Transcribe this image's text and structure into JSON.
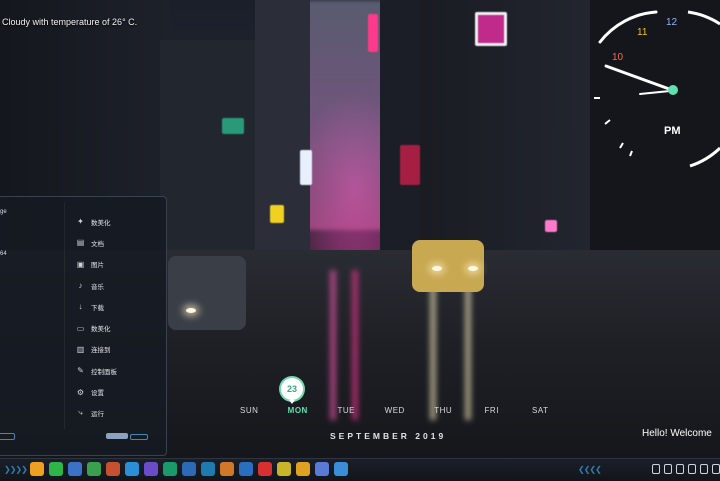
{
  "weather": {
    "text": "Cloudy with temperature of 26° C."
  },
  "clock": {
    "hour_labels": [
      "10",
      "11",
      "12"
    ],
    "period": "PM",
    "accent_color": "#5fe0b0"
  },
  "launcher": {
    "left_labels": [
      "ge",
      "64"
    ],
    "items": [
      {
        "label": "数美化",
        "icon": "puzzle-icon"
      },
      {
        "label": "文档",
        "icon": "document-icon"
      },
      {
        "label": "图片",
        "icon": "image-icon"
      },
      {
        "label": "音乐",
        "icon": "music-icon"
      },
      {
        "label": "下载",
        "icon": "download-icon"
      },
      {
        "label": "数美化",
        "icon": "monitor-icon"
      },
      {
        "label": "连接到",
        "icon": "connect-icon"
      },
      {
        "label": "控制面板",
        "icon": "control-panel-icon"
      },
      {
        "label": "设置",
        "icon": "gear-icon"
      },
      {
        "label": "运行",
        "icon": "run-icon"
      }
    ]
  },
  "calendar": {
    "days": [
      "SUN",
      "MON",
      "TUE",
      "WED",
      "THU",
      "FRI",
      "SAT"
    ],
    "active_day": "MON",
    "date": "23",
    "month_year": "SEPTEMBER 2019"
  },
  "welcome": {
    "text": "Hello! Welcome"
  },
  "taskbar": {
    "apps": [
      {
        "icon": "paw-icon",
        "color": "#f0a020"
      },
      {
        "icon": "wechat-icon",
        "color": "#2db54a"
      },
      {
        "icon": "photo-icon",
        "color": "#3a72c8"
      },
      {
        "icon": "green-app-icon",
        "color": "#3aa050"
      },
      {
        "icon": "mountain-icon",
        "color": "#c65030"
      },
      {
        "icon": "browser-icon",
        "color": "#2a8fd8"
      },
      {
        "icon": "player-icon",
        "color": "#6a4cc8"
      },
      {
        "icon": "terminal-icon",
        "color": "#1a9a6a"
      },
      {
        "icon": "notes-icon",
        "color": "#2c6ab8"
      },
      {
        "icon": "screen-icon",
        "color": "#1f7ab0"
      },
      {
        "icon": "cube-icon",
        "color": "#d07828"
      },
      {
        "icon": "window-icon",
        "color": "#2a6ec0"
      },
      {
        "icon": "weibo-icon",
        "color": "#d83030"
      },
      {
        "icon": "puzzle-app-icon",
        "color": "#c8b428"
      },
      {
        "icon": "folder-icon",
        "color": "#e0a020"
      },
      {
        "icon": "ghost-icon",
        "color": "#5a7ad8"
      },
      {
        "icon": "chrome-icon",
        "color": "#3a8ed8"
      }
    ],
    "accent_color": "#2f7fb0"
  }
}
